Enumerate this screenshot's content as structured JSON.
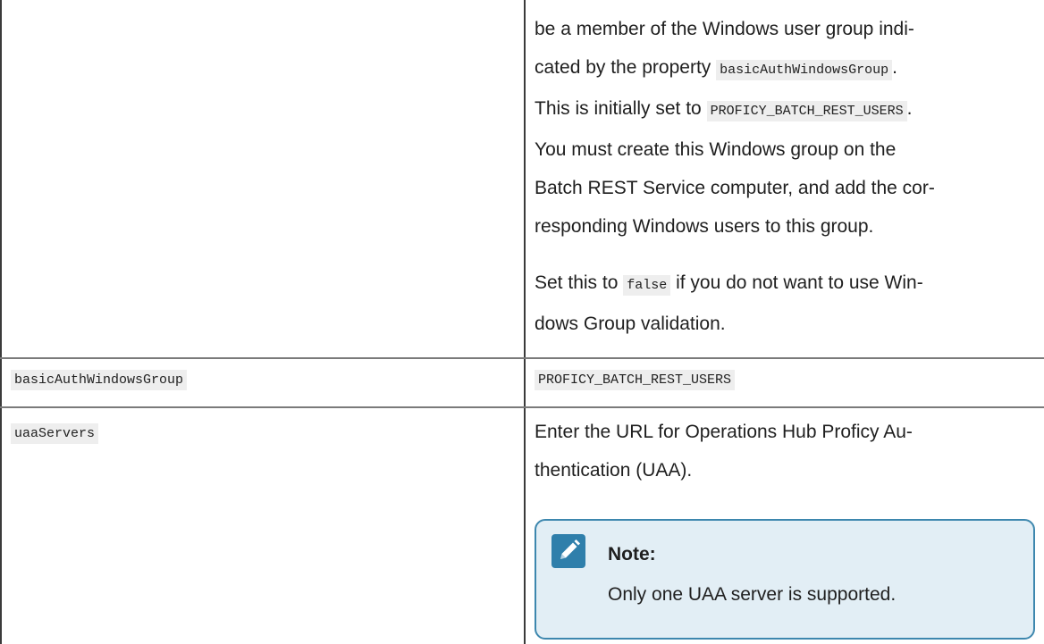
{
  "row1": {
    "description_lines": [
      {
        "parts": [
          {
            "text": "be a member of the Windows user group indi-"
          }
        ]
      },
      {
        "parts": [
          {
            "text": "cated by the property "
          },
          {
            "code": "basicAuthWindowsGroup"
          },
          {
            "text": "."
          }
        ]
      },
      {
        "parts": [
          {
            "text": "This is initially set to "
          },
          {
            "code": "PROFICY_BATCH_REST_USERS"
          },
          {
            "text": "."
          }
        ]
      },
      {
        "parts": [
          {
            "text": "You must create this Windows group on the"
          }
        ]
      },
      {
        "parts": [
          {
            "text": "Batch REST Service computer, and add the cor-"
          }
        ]
      },
      {
        "parts": [
          {
            "text": "responding Windows users to this group."
          }
        ]
      }
    ],
    "second_paragraph_lines": [
      {
        "parts": [
          {
            "text": "Set this to "
          },
          {
            "code": "false"
          },
          {
            "text": " if you do not want to use Win-"
          }
        ]
      },
      {
        "parts": [
          {
            "text": "dows Group validation."
          }
        ]
      }
    ]
  },
  "row2": {
    "property": "basicAuthWindowsGroup",
    "value": "PROFICY_BATCH_REST_USERS"
  },
  "row3": {
    "property": "uaaServers",
    "description_lines": [
      {
        "parts": [
          {
            "text": "Enter the URL for Operations Hub Proficy Au-"
          }
        ]
      },
      {
        "parts": [
          {
            "text": "thentication (UAA)."
          }
        ]
      }
    ],
    "note": {
      "title": "Note:",
      "body": "Only one UAA server is supported.",
      "icon": "pencil-note-icon"
    }
  },
  "colors": {
    "note_border": "#3d87ae",
    "note_background": "#e2eef5",
    "note_icon": "#2f7fab",
    "code_background": "#eeeeee"
  }
}
